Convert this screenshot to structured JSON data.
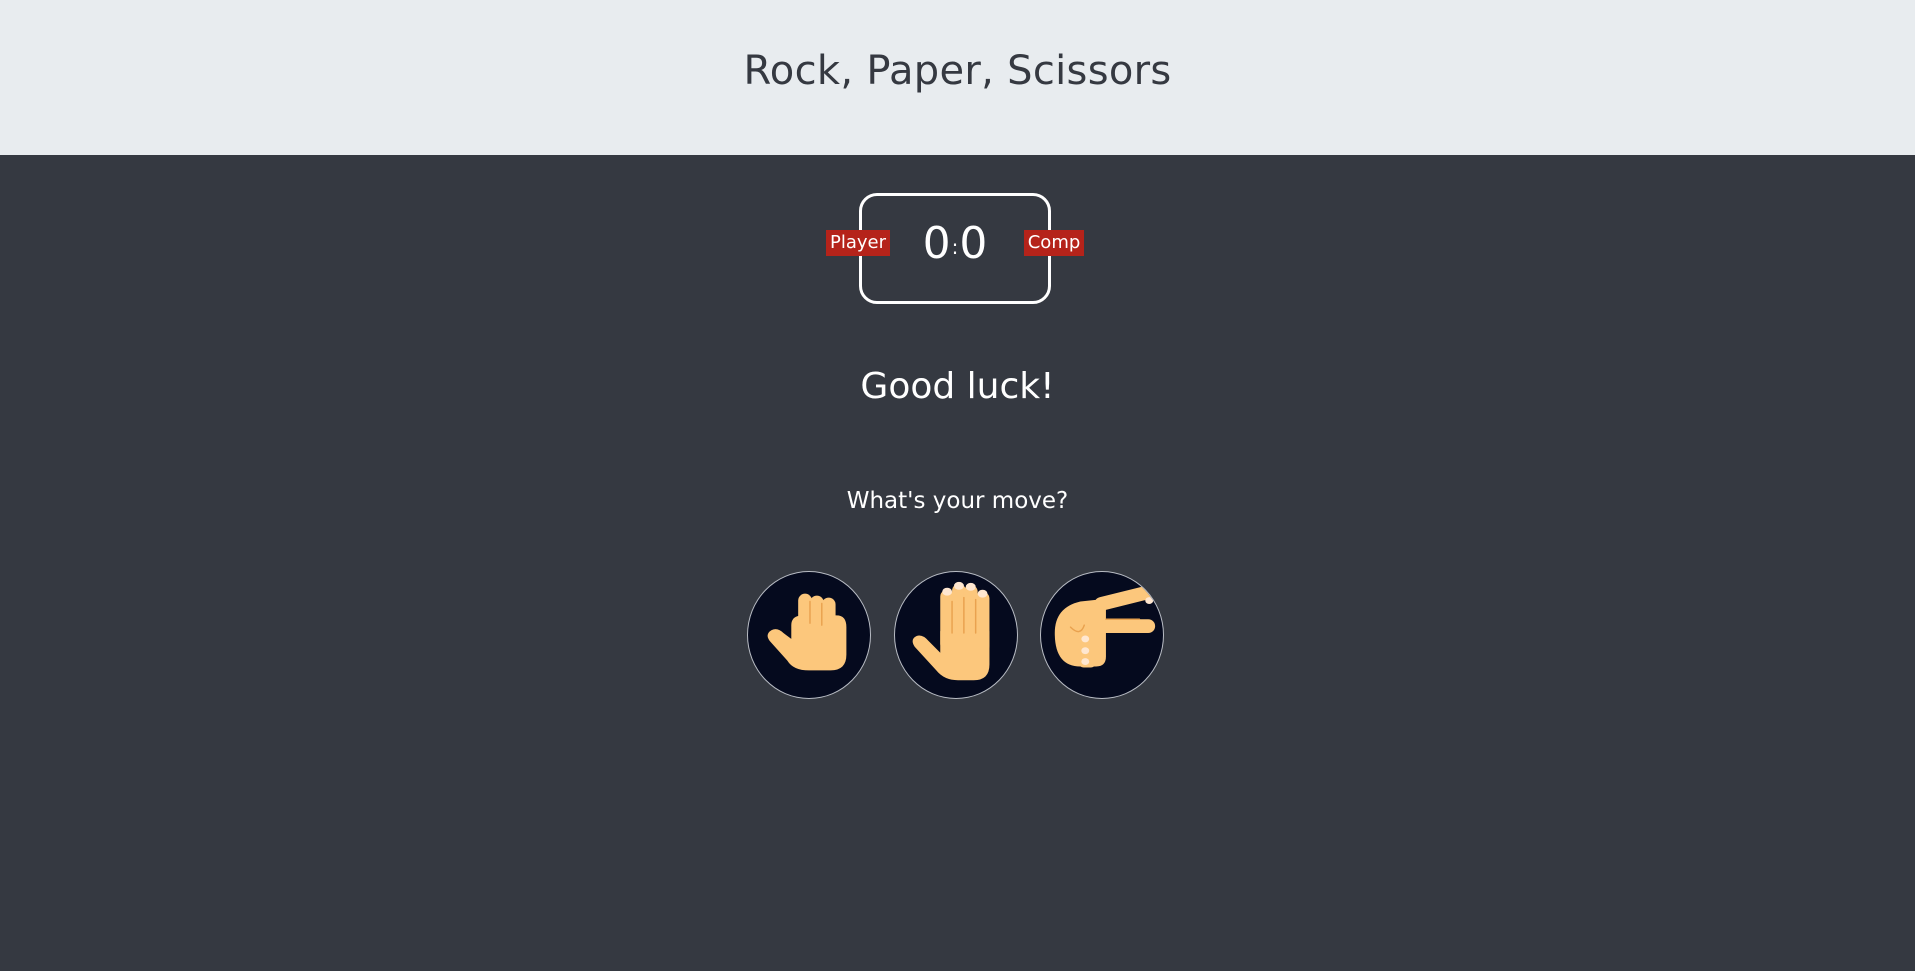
{
  "header": {
    "title": "Rock, Paper, Scissors"
  },
  "scoreboard": {
    "player_label": "Player",
    "comp_label": "Comp",
    "player_score": "0",
    "separator": ":",
    "comp_score": "0"
  },
  "message": "Good luck!",
  "prompt": "What's your move?",
  "choices": [
    {
      "name": "rock",
      "icon": "rock-hand-icon"
    },
    {
      "name": "paper",
      "icon": "paper-hand-icon"
    },
    {
      "name": "scissors",
      "icon": "scissors-hand-icon"
    }
  ],
  "colors": {
    "header_bg": "#e8ecef",
    "page_bg": "#353941",
    "badge_bg": "#b5231a",
    "choice_bg": "#050a1e",
    "skin": "#fcc77c"
  }
}
